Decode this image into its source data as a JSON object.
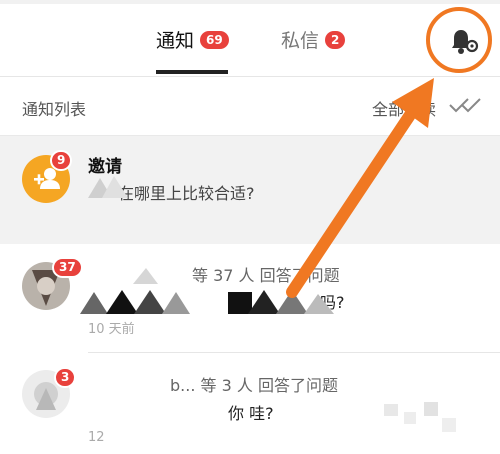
{
  "tabs": [
    {
      "label": "通知",
      "badge": "69",
      "active": true
    },
    {
      "label": "私信",
      "badge": "2",
      "active": false
    }
  ],
  "header": {
    "settings_icon": "bell-gear-icon",
    "list_title": "通知列表",
    "mark_all_label": "全部已读",
    "mark_all_icon": "double-check-icon"
  },
  "notifications": [
    {
      "type": "invite",
      "avatar_icon": "add-user-icon",
      "badge": "9",
      "title": "邀请",
      "subtitle": "在哪里上比较合适?"
    },
    {
      "badge": "37",
      "header": "等 37 人 回答了问题",
      "body": "吗?",
      "time": "10 天前"
    },
    {
      "badge": "3",
      "header": "b... 等 3 人 回答了问题",
      "body": "你 哇?",
      "time": "12"
    }
  ],
  "colors": {
    "accent": "#e8413c",
    "invite_avatar": "#f5a623",
    "annotation": "#f07822"
  }
}
